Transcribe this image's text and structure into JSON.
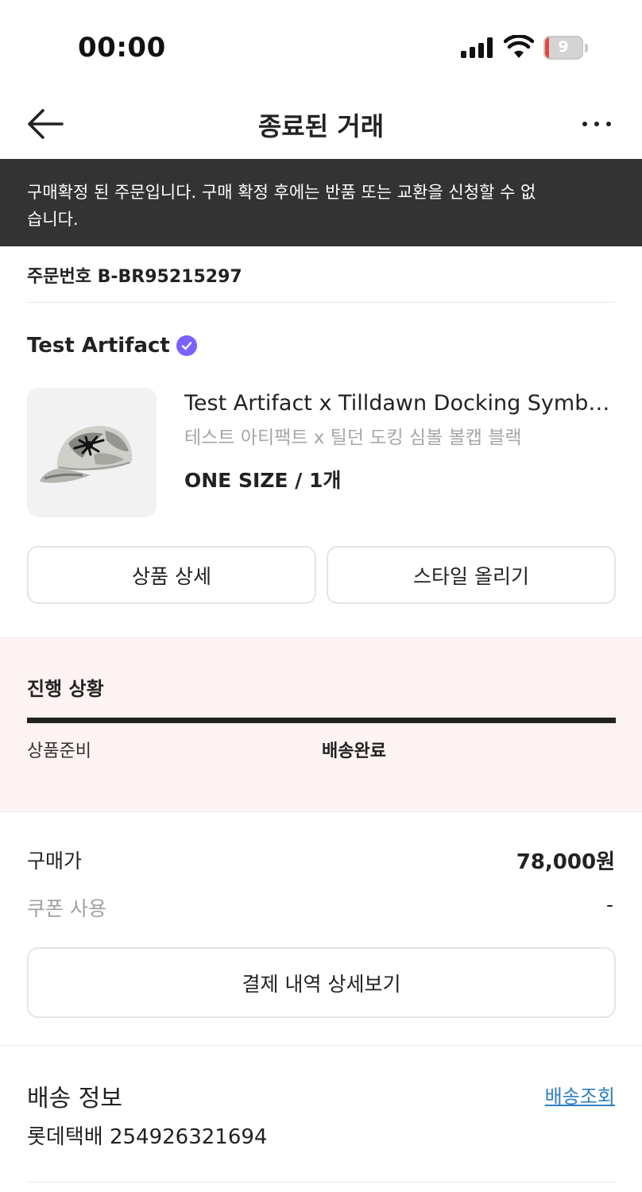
{
  "status_bar": {
    "time": "00:00",
    "battery": "9"
  },
  "nav": {
    "title": "종료된 거래"
  },
  "notice": {
    "text": "구매확정 된 주문입니다. 구매 확정 후에는 반품 또는 교환을 신청할 수 없습니다."
  },
  "order": {
    "number_label": "주문번호 B-BR95215297"
  },
  "product": {
    "brand": "Test Artifact",
    "name": "Test Artifact x Tilldawn Docking Symbol Ballcap Black",
    "name_ko": "테스트 아티팩트 x 틸던 도킹 심볼 볼캡 블랙",
    "option": "ONE SIZE / 1개",
    "detail_button": "상품 상세",
    "style_button": "스타일 올리기"
  },
  "progress": {
    "title": "진행 상황",
    "step1": "상품준비",
    "step2": "배송완료",
    "completion": 1.0
  },
  "payment": {
    "price_label": "구매가",
    "price_value": "78,000원",
    "coupon_label": "쿠폰 사용",
    "coupon_value": "-",
    "detail_button": "결제 내역 상세보기"
  },
  "shipping": {
    "title": "배송 정보",
    "track_link": "배송조회",
    "carrier": "롯데택배 254926321694"
  },
  "colors": {
    "notice_bg": "#333333",
    "verified_badge": "#7b61ff",
    "progress_bg": "#fdf3f2",
    "link": "#2c7fc7",
    "battery_low": "#e5473c"
  },
  "icons": [
    "signal-icon",
    "wifi-icon",
    "battery-icon",
    "back-arrow-icon",
    "more-icon",
    "verified-badge-icon"
  ]
}
